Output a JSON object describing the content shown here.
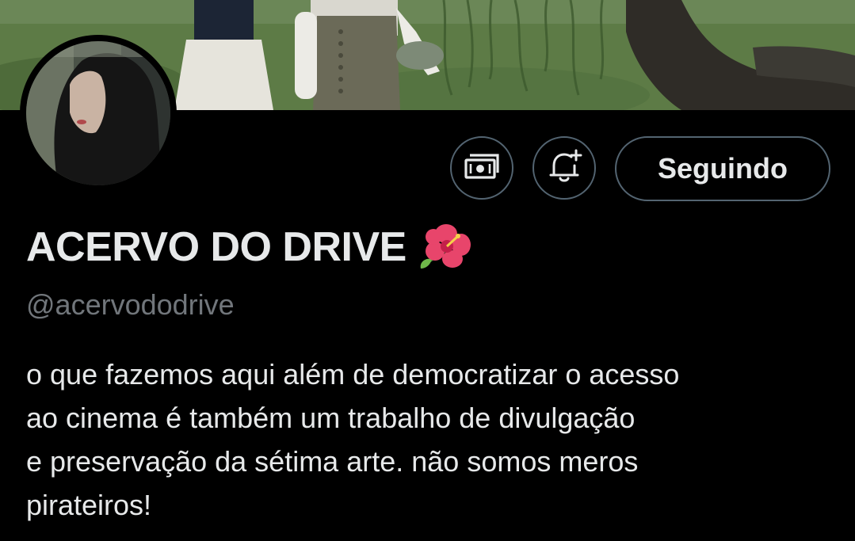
{
  "profile": {
    "display_name": "ACERVO DO DRIVE",
    "handle": "@acervododrive",
    "bio_lines": [
      "o que fazemos aqui além de democratizar o acesso",
      "ao cinema é também um trabalho de divulgação",
      "e preservação da sétima arte. não somos meros",
      "pirateiros!"
    ]
  },
  "actions": {
    "following_label": "Seguindo",
    "subscribe_icon": "money-icon",
    "notify_icon": "bell-plus-icon"
  },
  "colors": {
    "background": "#000000",
    "text": "#e7e9ea",
    "secondary_text": "#71767b",
    "button_border": "#536471"
  }
}
